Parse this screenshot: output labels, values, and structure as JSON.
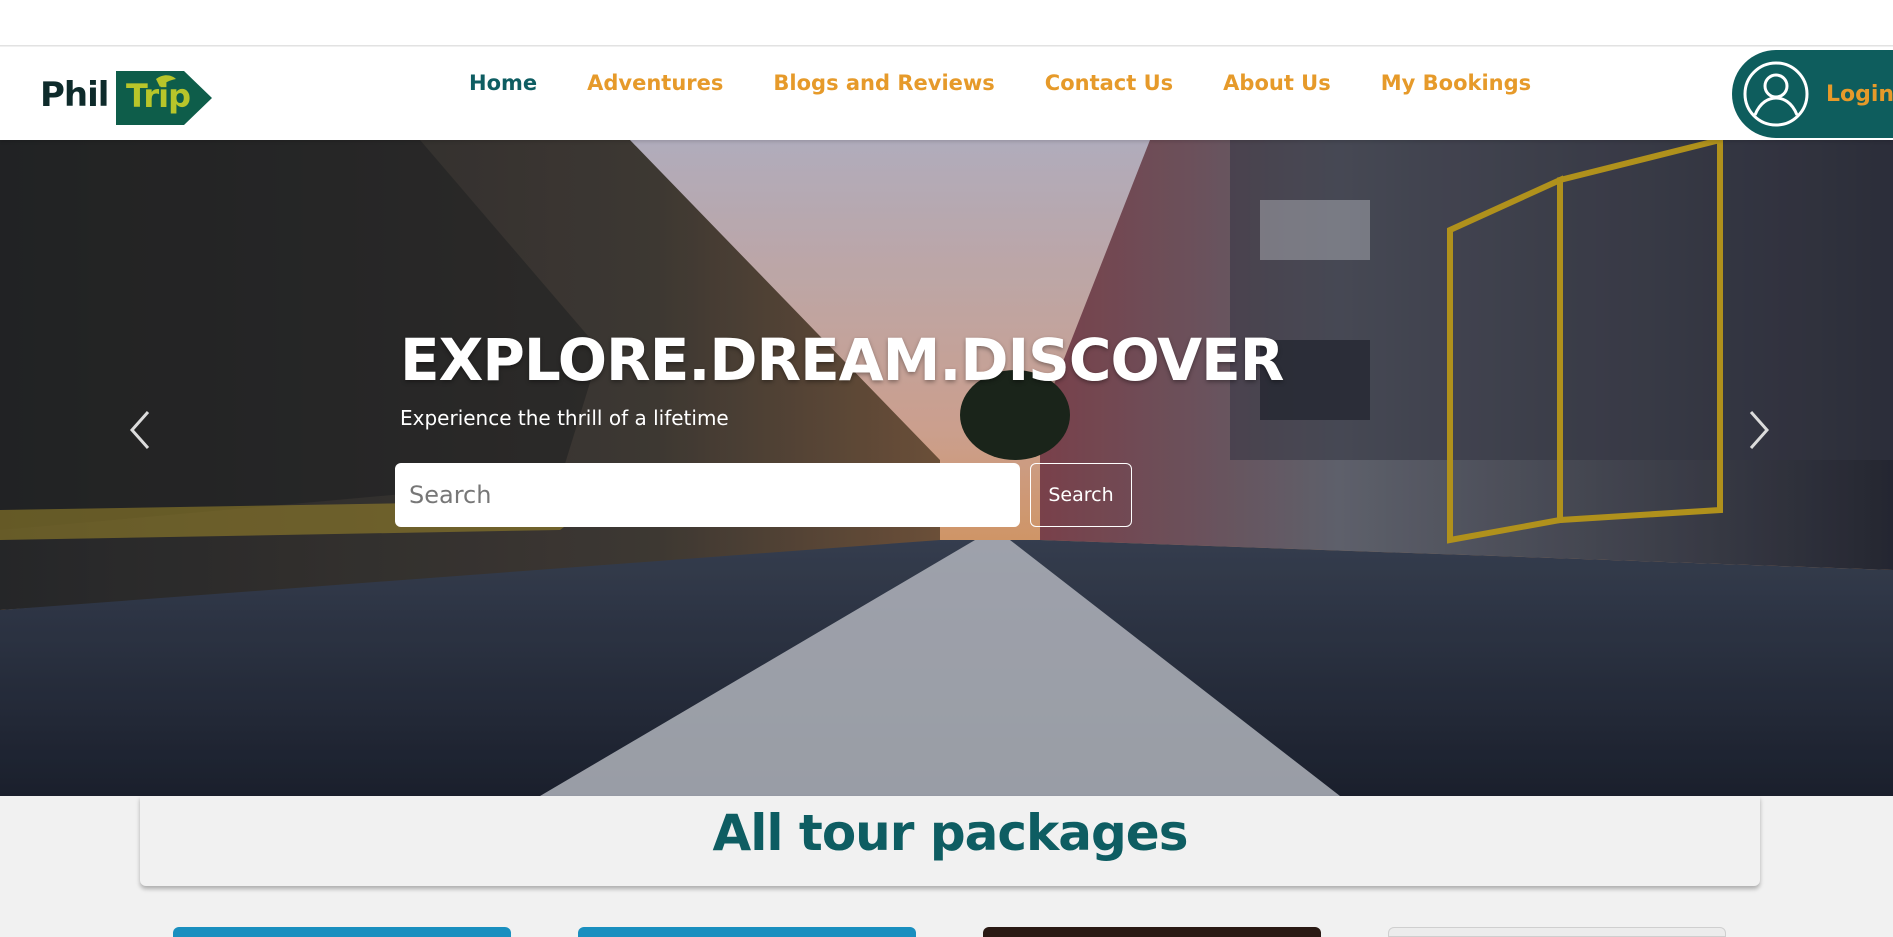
{
  "brand": {
    "logo_text_1": "Phil",
    "logo_text_2": "Trip",
    "logo_icon": "leaf-icon",
    "colors": {
      "primary_teal": "#0e5d62",
      "accent_orange": "#e69a2a",
      "logo_green": "#b8c52a"
    }
  },
  "nav": {
    "items": [
      {
        "label": "Home",
        "active": true
      },
      {
        "label": "Adventures",
        "active": false
      },
      {
        "label": "Blogs and Reviews",
        "active": false
      },
      {
        "label": "Contact Us",
        "active": false
      },
      {
        "label": "About Us",
        "active": false
      },
      {
        "label": "My Bookings",
        "active": false
      }
    ],
    "login": {
      "label": "Login",
      "icon": "user-avatar-icon"
    }
  },
  "hero": {
    "title": "EXPLORE.DREAM.DISCOVER",
    "subtitle": "Experience the thrill of a lifetime",
    "search": {
      "placeholder": "Search",
      "value": "",
      "button_label": "Search"
    },
    "prev_icon": "chevron-left-icon",
    "next_icon": "chevron-right-icon"
  },
  "packages": {
    "section_title": "All tour packages",
    "card_colors": [
      "#1a8fbf",
      "#1a8fbf",
      "#2a1a14",
      "#ececec"
    ]
  }
}
